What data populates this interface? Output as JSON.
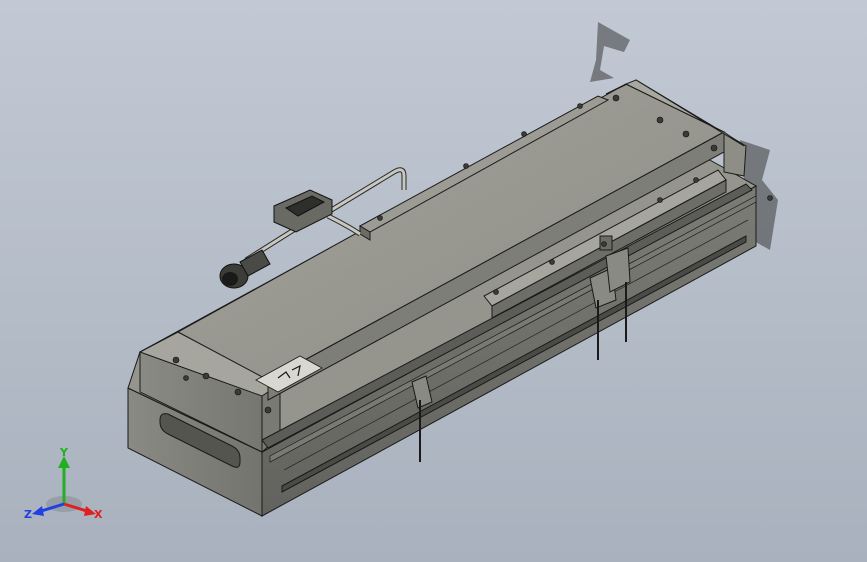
{
  "app": {
    "title": ""
  },
  "viewport": {
    "background_top": "#c2c9d4",
    "background_bottom": "#a9b1be"
  },
  "model": {
    "name": "",
    "body_color": "#8c8c84",
    "rail_color": "#6e6e68",
    "edge_color": "#1a1a1a"
  },
  "triad": {
    "x_label": "X",
    "y_label": "Y",
    "z_label": "Z",
    "x_color": "#e02020",
    "y_color": "#20b020",
    "z_color": "#2040e0"
  }
}
